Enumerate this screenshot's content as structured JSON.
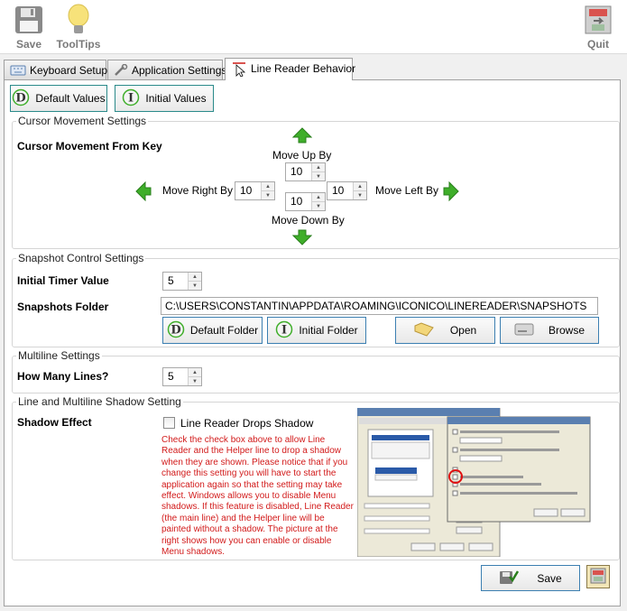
{
  "toolbar": {
    "save": "Save",
    "tooltips": "ToolTips",
    "quit": "Quit"
  },
  "tabs": [
    "Keyboard Setup",
    "Application Settings",
    "Line Reader Behavior"
  ],
  "values_buttons": {
    "default": "Default Values",
    "initial": "Initial Values"
  },
  "cursor": {
    "group_title": "Cursor Movement Settings",
    "heading": "Cursor Movement From Key",
    "up_label": "Move Up By",
    "up_value": "10",
    "right_label": "Move Right By",
    "right_value": "10",
    "left_label": "Move Left By",
    "left_value": "10",
    "down_label": "Move Down By",
    "down_value": "10"
  },
  "snapshot": {
    "group_title": "Snapshot Control Settings",
    "timer_label": "Initial Timer Value",
    "timer_value": "5",
    "folder_label": "Snapshots Folder",
    "folder_path": "C:\\USERS\\CONSTANTIN\\APPDATA\\ROAMING\\ICONICO\\LINEREADER\\SNAPSHOTS",
    "default_folder": "Default Folder",
    "initial_folder": "Initial Folder",
    "open": "Open",
    "browse": "Browse"
  },
  "multiline": {
    "group_title": "Multiline Settings",
    "lines_label": "How Many Lines?",
    "lines_value": "5"
  },
  "shadow": {
    "group_title": "Line and Multiline Shadow Setting",
    "effect_label": "Shadow Effect",
    "checkbox_label": "Line Reader Drops Shadow",
    "checked": false,
    "note": "Check the check box above to allow Line Reader and the Helper line to drop a shadow when they are shown. Please notice that if you change this setting you will have to start the application again so that the setting may take effect. Windows allows you to disable Menu shadows. If this feature is disabled, Line Reader (the main line) and the Helper line will be painted without a shadow. The picture at the right shows how you can enable or disable Menu shadows."
  },
  "footer": {
    "save": "Save"
  },
  "colors": {
    "accent_green": "#3fae2a",
    "note_red": "#d21a1a",
    "button_border": "#3c7fb1"
  }
}
